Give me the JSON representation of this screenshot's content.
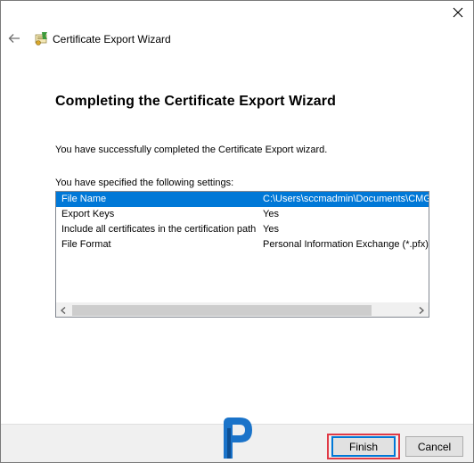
{
  "window": {
    "title": "Certificate Export Wizard",
    "close_icon": "close-icon",
    "back_icon": "back-arrow-icon",
    "wizard_icon": "certificate-wizard-icon"
  },
  "main": {
    "heading": "Completing the Certificate Export Wizard",
    "success_text": "You have successfully completed the Certificate Export wizard.",
    "settings_label": "You have specified the following settings:"
  },
  "settings": {
    "rows": [
      {
        "name": "File Name",
        "value": "C:\\Users\\sccmadmin\\Documents\\CMG-",
        "selected": true
      },
      {
        "name": "Export Keys",
        "value": "Yes",
        "selected": false
      },
      {
        "name": "Include all certificates in the certification path",
        "value": "Yes",
        "selected": false
      },
      {
        "name": "File Format",
        "value": "Personal Information Exchange (*.pfx)",
        "selected": false
      }
    ]
  },
  "footer": {
    "finish_label": "Finish",
    "cancel_label": "Cancel",
    "logo": "prajwal-logo"
  },
  "colors": {
    "selection": "#0078d7",
    "highlight_outline": "#e03a46",
    "footer_bg": "#f0f0f0"
  }
}
